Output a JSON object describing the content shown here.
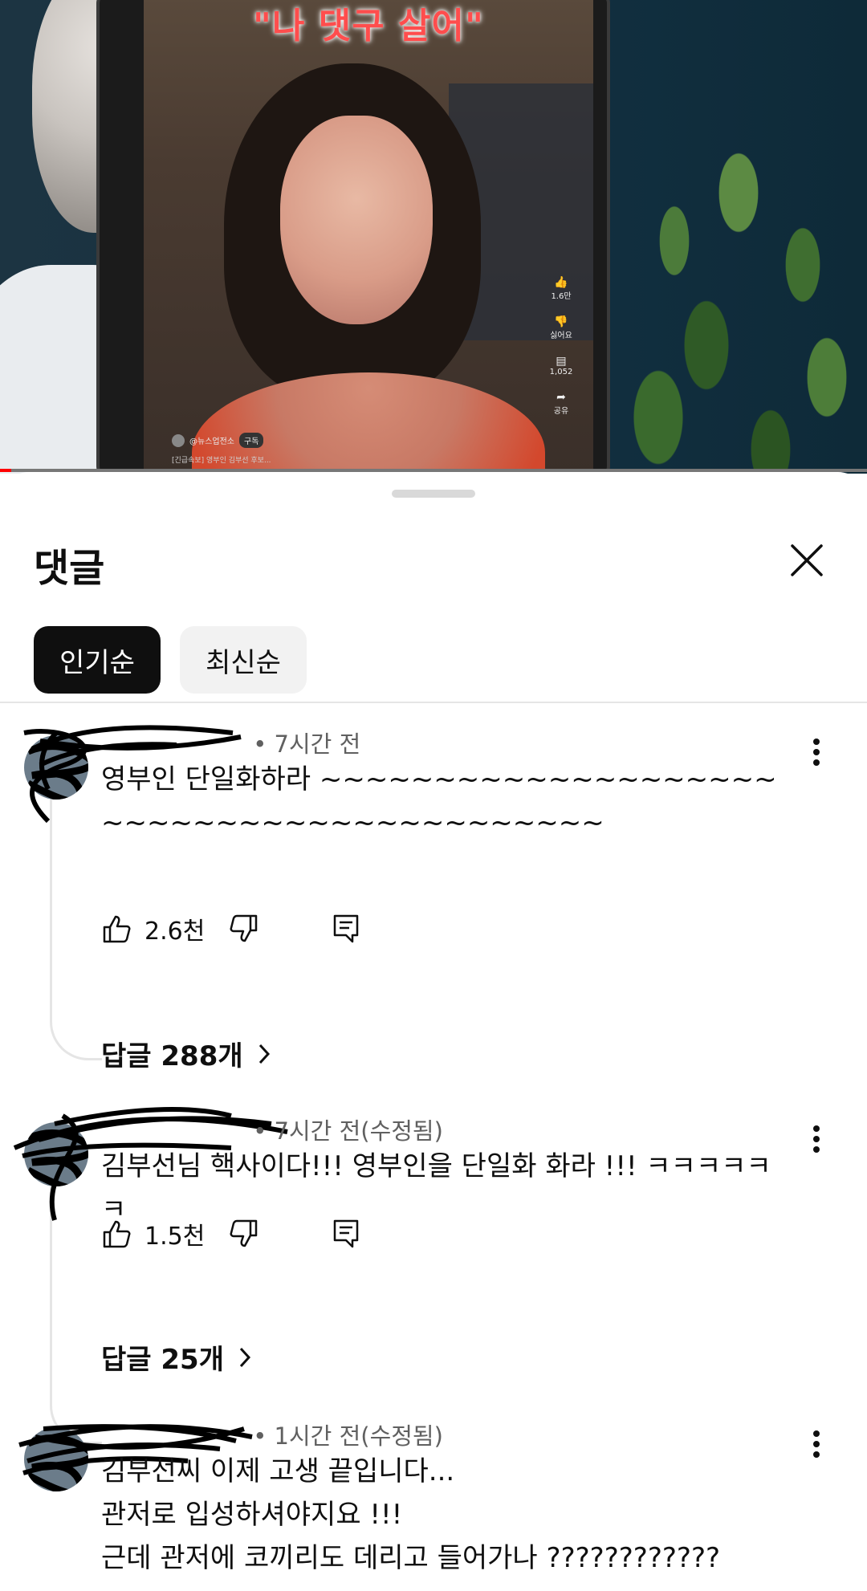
{
  "video": {
    "overlay_title": "\"나 댓구 살어\"",
    "side_actions": [
      {
        "icon": "thumbs-up-icon",
        "label": "1.6만"
      },
      {
        "icon": "thumbs-down-icon",
        "label": "싫어요"
      },
      {
        "icon": "comment-icon",
        "label": "1,052"
      },
      {
        "icon": "share-icon",
        "label": "공유"
      }
    ],
    "channel_handle": "@뉴스업전소",
    "subscribe_label": "구독",
    "caption": "[긴급속보] 영부인 김부선 후보..."
  },
  "sheet": {
    "title": "댓글",
    "close_icon": "close-icon",
    "chips": [
      "인기순",
      "최신순"
    ]
  },
  "comments": [
    {
      "time": "7시간 전",
      "text": "영부인 단일화하라 ~~~~~~~~~~~~~~~~~~~~~~~~~~~~~~~~~~~~~~~~~~",
      "likes": "2.6천",
      "replies": "답글 288개"
    },
    {
      "time": "7시간 전(수정됨)",
      "text": "김부선님 핵사이다!!! 영부인을 단일화 화라 !!! ㅋㅋㅋㅋㅋㅋ",
      "likes": "1.5천",
      "replies": "답글 25개"
    },
    {
      "time": "1시간 전(수정됨)",
      "text": "김부선씨 이제 고생 끝입니다...\n관저로 입성하셔야지요 !!!\n근데 관저에 코끼리도 데리고 들어가나 ????????????"
    }
  ],
  "colors": {
    "accent": "#ff0000",
    "text": "#0f0f0f",
    "secondary": "#606060",
    "chip_bg": "#f2f2f2"
  }
}
